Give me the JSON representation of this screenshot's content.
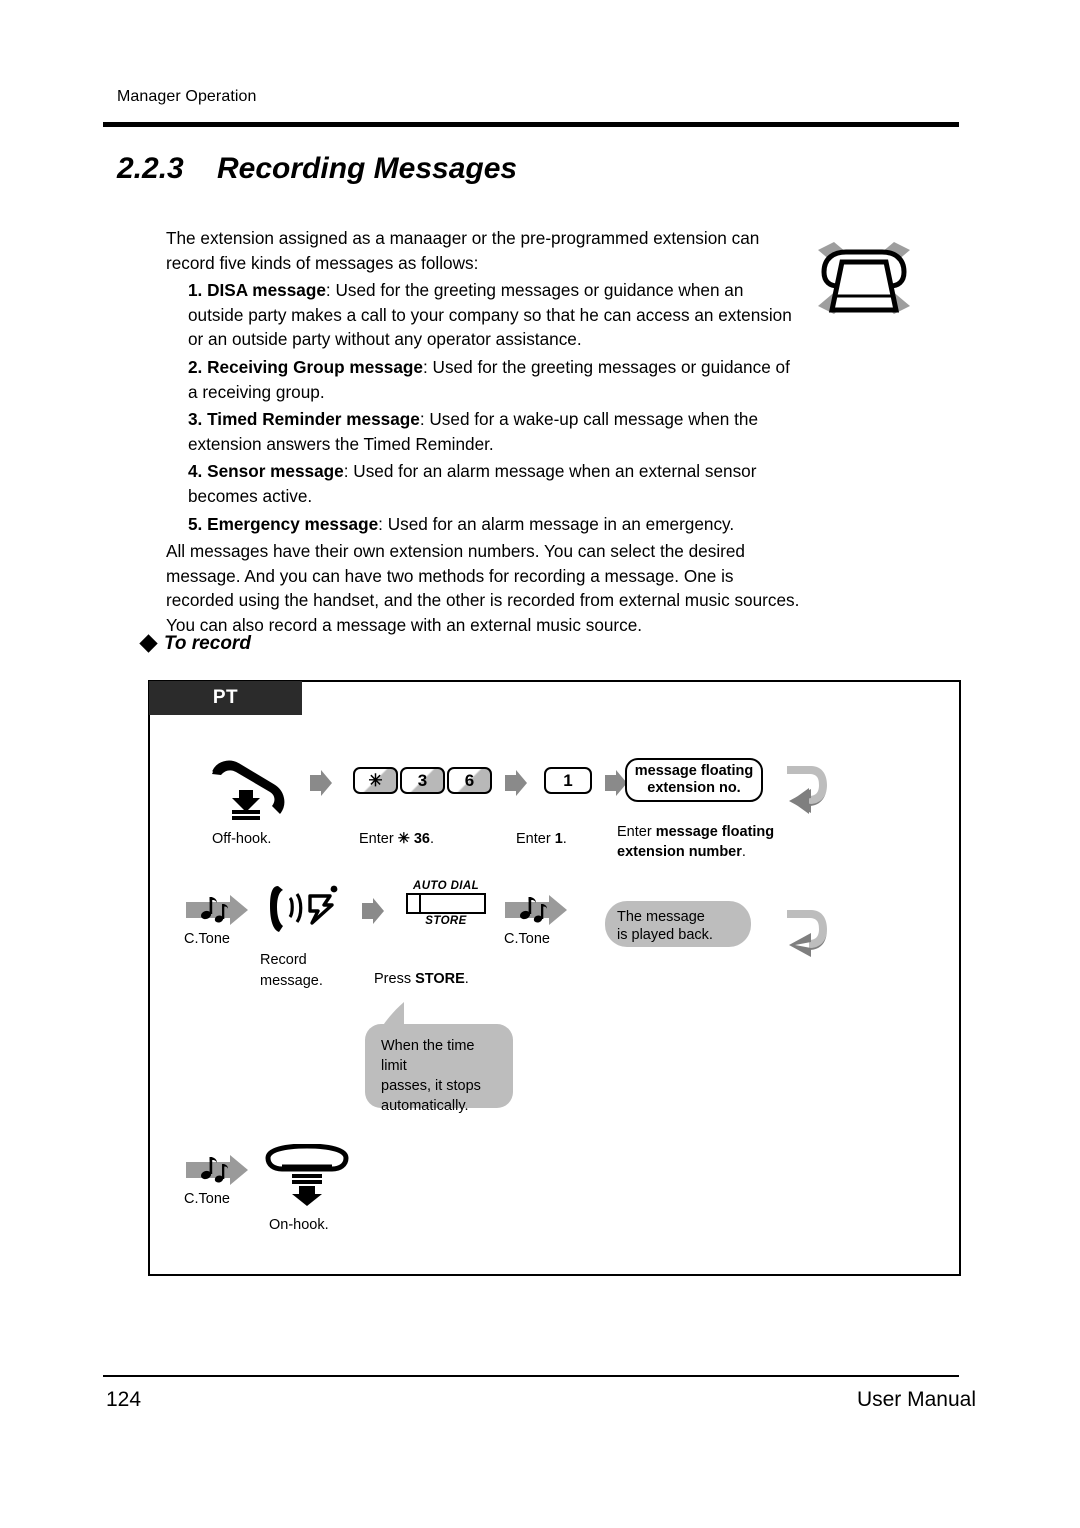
{
  "header": {
    "running_head": "Manager Operation"
  },
  "section": {
    "number": "2.2.3",
    "title": "Recording Messages"
  },
  "body": {
    "intro": "The extension assigned as a manaager or the pre-programmed extension can record five kinds of messages as follows:",
    "items": [
      {
        "label": "1. DISA message",
        "text": ": Used for the greeting messages or guidance when an outside party makes a call to your company so that he can access an extension or an outside party without any operator assistance."
      },
      {
        "label": "2. Receiving Group message",
        "text": ": Used for the greeting messages or guidance of a receiving group."
      },
      {
        "label": "3. Timed Reminder message",
        "text": ": Used for a wake-up call message when the extension answers the Timed Reminder."
      },
      {
        "label": "4. Sensor message",
        "text": ": Used for an alarm message when an external sensor becomes active."
      },
      {
        "label": "5. Emergency message",
        "text": ": Used for an alarm message in an emergency."
      }
    ],
    "tail": "All messages have their own extension numbers. You can select the desired message. And you can have two methods for recording a message. One is recorded using the handset, and the other is recorded from external music sources. You can also record a message with an external music source."
  },
  "to_record": {
    "heading": "To record"
  },
  "flow": {
    "tab_label": "PT",
    "row1": {
      "offhook_caption": "Off-hook.",
      "keys": [
        "✳",
        "3",
        "6"
      ],
      "enter_code_prefix": "Enter ",
      "enter_code_value": "✳ 36",
      "enter_code_suffix": ".",
      "key_one": "1",
      "enter_one_prefix": "Enter ",
      "enter_one_value": "1",
      "enter_one_suffix": ".",
      "pill_line1": "message floating",
      "pill_line2": "extension no.",
      "pill_caption_prefix": "Enter ",
      "pill_caption_bold1": "message floating",
      "pill_caption_bold2": "extension number",
      "pill_caption_suffix": "."
    },
    "row2": {
      "ctone_left": "C.Tone",
      "record_line1": "Record",
      "record_line2": "message.",
      "autodial_top": "AUTO DIAL",
      "autodial_bottom": "STORE",
      "press_store_prefix": "Press ",
      "press_store_bold": "STORE",
      "press_store_suffix": ".",
      "ctone_right": "C.Tone",
      "playback_line1": "The message",
      "playback_line2": "is played back.",
      "note_line1": "When the time limit",
      "note_line2": "passes, it stops",
      "note_line3": "automatically."
    },
    "row3": {
      "ctone": "C.Tone",
      "onhook_caption": "On-hook."
    }
  },
  "footer": {
    "page_number": "124",
    "manual_label": "User Manual"
  },
  "colors": {
    "ink": "#000000",
    "tab_bg": "#2b2b2b",
    "gray_fill": "#bdbdbd",
    "arrow_gray": "#808080",
    "key_shade": "#b8b8b8"
  }
}
